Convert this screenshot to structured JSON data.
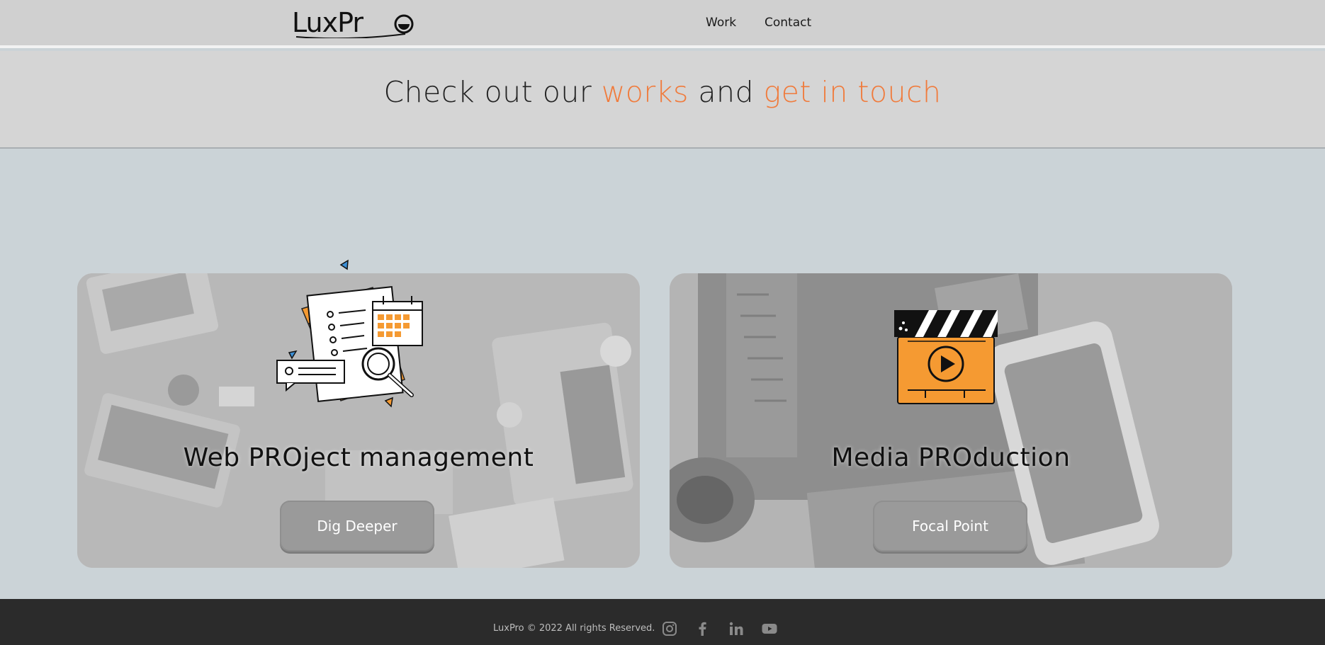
{
  "brand": {
    "logo_text": "LuxPro"
  },
  "nav": {
    "work": "Work",
    "contact": "Contact"
  },
  "hero": {
    "part1": "Check out our ",
    "works": "works",
    "part2": " and ",
    "touch": "get in touch"
  },
  "cards": [
    {
      "title": "Web PROject management",
      "button": "Dig Deeper",
      "icon": "project-management-illustration"
    },
    {
      "title": "Media PROduction",
      "button": "Focal Point",
      "icon": "clapperboard-play-illustration"
    }
  ],
  "footer": {
    "copyright": "LuxPro © 2022 All rights Reserved.",
    "social": [
      "instagram-icon",
      "facebook-icon",
      "linkedin-icon",
      "youtube-icon"
    ]
  },
  "colors": {
    "accent": "#f07b3c",
    "illustration_orange": "#f59a32",
    "footer_bg": "#2b2b2b"
  }
}
